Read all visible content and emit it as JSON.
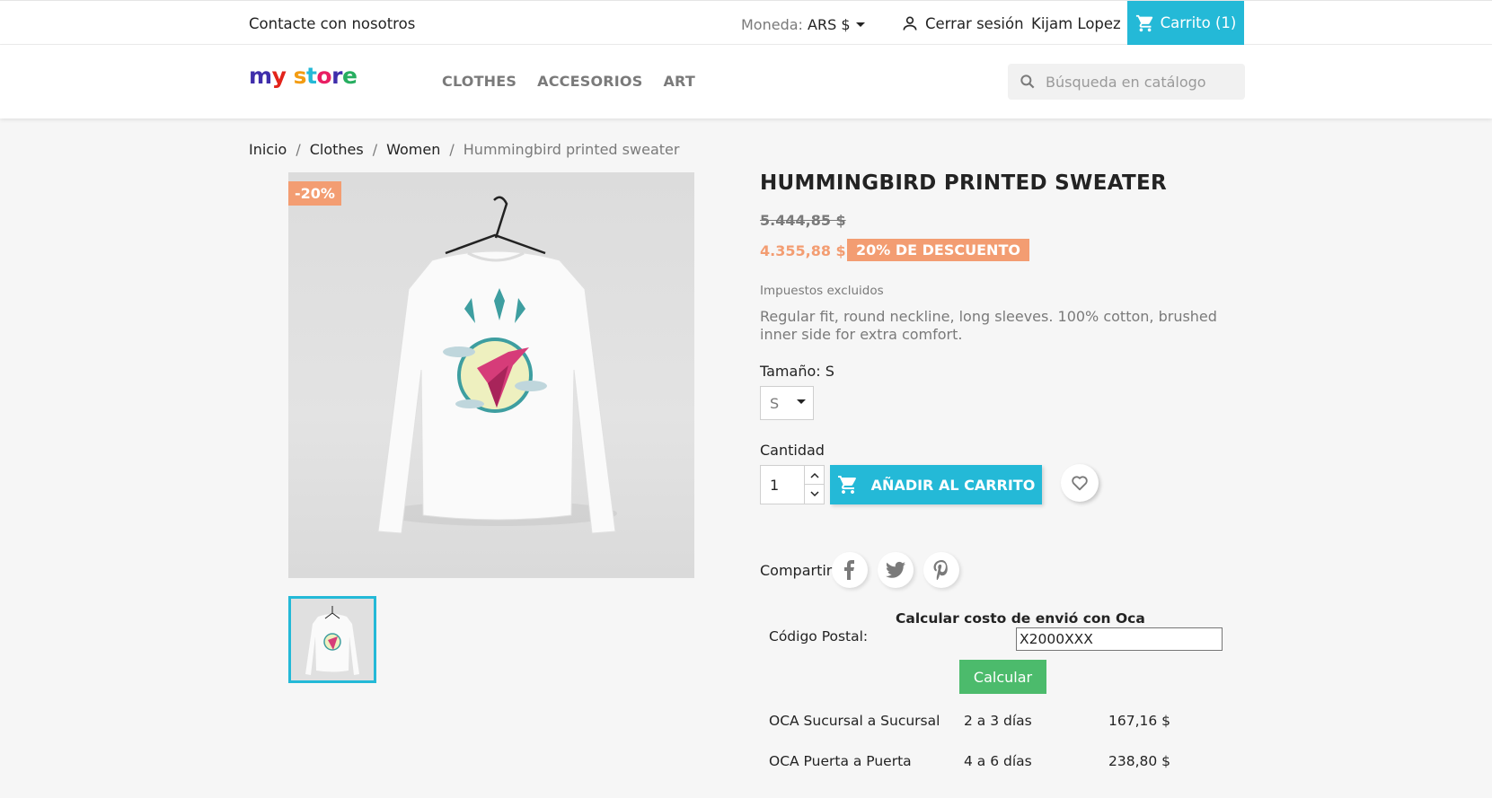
{
  "topbar": {
    "contact": "Contacte con nosotros",
    "currency_label": "Moneda:",
    "currency_value": "ARS $",
    "logout": "Cerrar sesión",
    "username": "Kijam Lopez",
    "cart": "Carrito (1)"
  },
  "header": {
    "logo": {
      "m": "m",
      "y": "y",
      "s": "s",
      "t": "t",
      "o": "o",
      "r": "r",
      "e": "e"
    },
    "nav": [
      "CLOTHES",
      "ACCESORIOS",
      "ART"
    ],
    "search_placeholder": "Búsqueda en catálogo"
  },
  "breadcrumb": [
    "Inicio",
    "Clothes",
    "Women",
    "Hummingbird printed sweater"
  ],
  "breadcrumb_sep": "/",
  "product": {
    "discount_flag": "-20%",
    "title": "HUMMINGBIRD PRINTED SWEATER",
    "regular_price": "5.444,85 $",
    "price": "4.355,88 $",
    "discount_label": "20% DE DESCUENTO",
    "tax_note": "Impuestos excluidos",
    "description": "Regular fit, round neckline, long sleeves. 100% cotton, brushed inner side for extra comfort.",
    "size_label": "Tamaño: S",
    "size_value": "S",
    "quantity_label": "Cantidad",
    "quantity_value": "1",
    "add_to_cart": "AÑADIR AL CARRITO",
    "share_label": "Compartir"
  },
  "shipping": {
    "title": "Calcular costo de envió con Oca",
    "postal_label": "Código Postal:",
    "postal_value": "X2000XXX",
    "calc_button": "Calcular",
    "rates": [
      {
        "name": "OCA Sucursal a Sucursal",
        "time": "2 a 3 días",
        "cost": "167,16 $"
      },
      {
        "name": "OCA Puerta a Puerta",
        "time": "4 a 6 días",
        "cost": "238,80 $"
      }
    ]
  },
  "colors": {
    "accent": "#24b9d7",
    "discount": "#f39d72",
    "calc": "#4cbb6c"
  }
}
